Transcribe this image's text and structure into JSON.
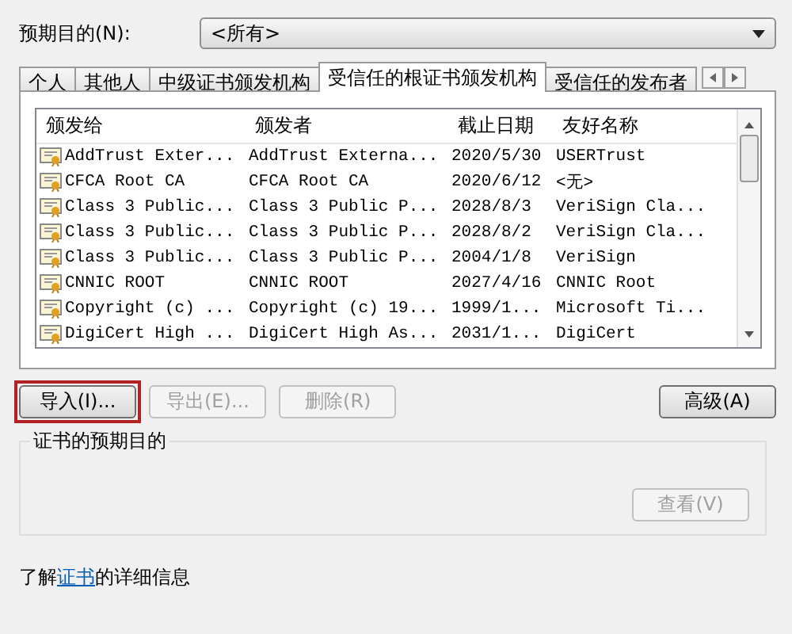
{
  "purpose": {
    "label": "预期目的(N):",
    "value": "<所有>"
  },
  "tabs": [
    {
      "label": "个人",
      "selected": false
    },
    {
      "label": "其他人",
      "selected": false
    },
    {
      "label": "中级证书颁发机构",
      "selected": false
    },
    {
      "label": "受信任的根证书颁发机构",
      "selected": true
    },
    {
      "label": "受信任的发布者",
      "selected": false
    }
  ],
  "table": {
    "columns": [
      "颁发给",
      "颁发者",
      "截止日期",
      "友好名称"
    ],
    "rows": [
      [
        "AddTrust Exter...",
        "AddTrust Externa...",
        "2020/5/30",
        "USERTrust"
      ],
      [
        "CFCA Root CA",
        "CFCA Root CA",
        "2020/6/12",
        "<无>"
      ],
      [
        "Class 3 Public...",
        "Class 3 Public P...",
        "2028/8/3",
        "VeriSign Cla..."
      ],
      [
        "Class 3 Public...",
        "Class 3 Public P...",
        "2028/8/2",
        "VeriSign Cla..."
      ],
      [
        "Class 3 Public...",
        "Class 3 Public P...",
        "2004/1/8",
        "VeriSign"
      ],
      [
        "CNNIC ROOT",
        "CNNIC ROOT",
        "2027/4/16",
        "CNNIC Root"
      ],
      [
        "Copyright (c) ...",
        "Copyright (c) 19...",
        "1999/1...",
        "Microsoft Ti..."
      ],
      [
        "DigiCert High ...",
        "DigiCert High As...",
        "2031/1...",
        "DigiCert"
      ]
    ]
  },
  "buttons": [
    {
      "label": "导入(I)...",
      "disabled": false,
      "highlighted": true
    },
    {
      "label": "导出(E)...",
      "disabled": true,
      "highlighted": false
    },
    {
      "label": "删除(R)",
      "disabled": true,
      "highlighted": false
    }
  ],
  "advanced_button": {
    "label": "高级(A)",
    "disabled": false
  },
  "purpose_group": {
    "title": "证书的预期目的",
    "view_button": {
      "label": "查看(V)",
      "disabled": true
    }
  },
  "footer": {
    "before": "了解",
    "link": "证书",
    "after": "的详细信息"
  }
}
